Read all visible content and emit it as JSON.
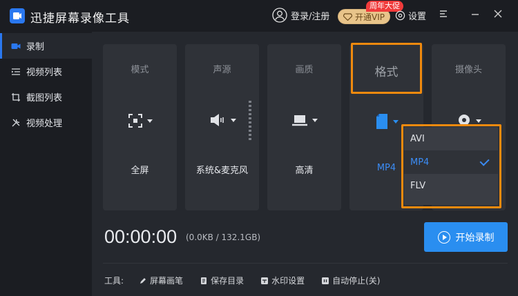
{
  "app": {
    "title": "迅捷屏幕录像工具"
  },
  "header": {
    "login_label": "登录/注册",
    "vip_label": "开通VIP",
    "promo_badge": "周年大促",
    "settings_label": "设置"
  },
  "sidebar": {
    "items": [
      {
        "label": "录制",
        "icon": "video-camera-icon",
        "active": true
      },
      {
        "label": "视频列表",
        "icon": "list-icon",
        "active": false
      },
      {
        "label": "截图列表",
        "icon": "screenshot-icon",
        "active": false
      },
      {
        "label": "视频处理",
        "icon": "tools-icon",
        "active": false
      }
    ]
  },
  "cards": [
    {
      "title": "模式",
      "value": "全屏",
      "icon": "fullscreen-icon"
    },
    {
      "title": "声源",
      "value": "系统&麦克风",
      "icon": "speaker-icon"
    },
    {
      "title": "画质",
      "value": "高清",
      "icon": "laptop-icon"
    },
    {
      "title": "格式",
      "value": "MP4",
      "icon": "file-icon"
    },
    {
      "title": "摄像头",
      "value": "",
      "icon": "webcam-icon"
    }
  ],
  "format_dropdown": {
    "options": [
      "AVI",
      "MP4",
      "FLV"
    ],
    "selected": "MP4"
  },
  "status": {
    "timer": "00:00:00",
    "disk": "(0.0KB / 132.1GB)"
  },
  "record_button": {
    "label": "开始录制"
  },
  "toolbar": {
    "label": "工具:",
    "items": [
      {
        "label": "屏幕画笔",
        "icon": "pen-icon"
      },
      {
        "label": "保存目录",
        "icon": "folder-icon"
      },
      {
        "label": "水印设置",
        "icon": "watermark-icon"
      },
      {
        "label": "自动停止(关)",
        "icon": "timer-stop-icon"
      }
    ]
  },
  "colors": {
    "accent": "#2a78f0",
    "highlight": "#f08a0e",
    "vip": "#e8c48a",
    "promo": "#f03b3b"
  }
}
